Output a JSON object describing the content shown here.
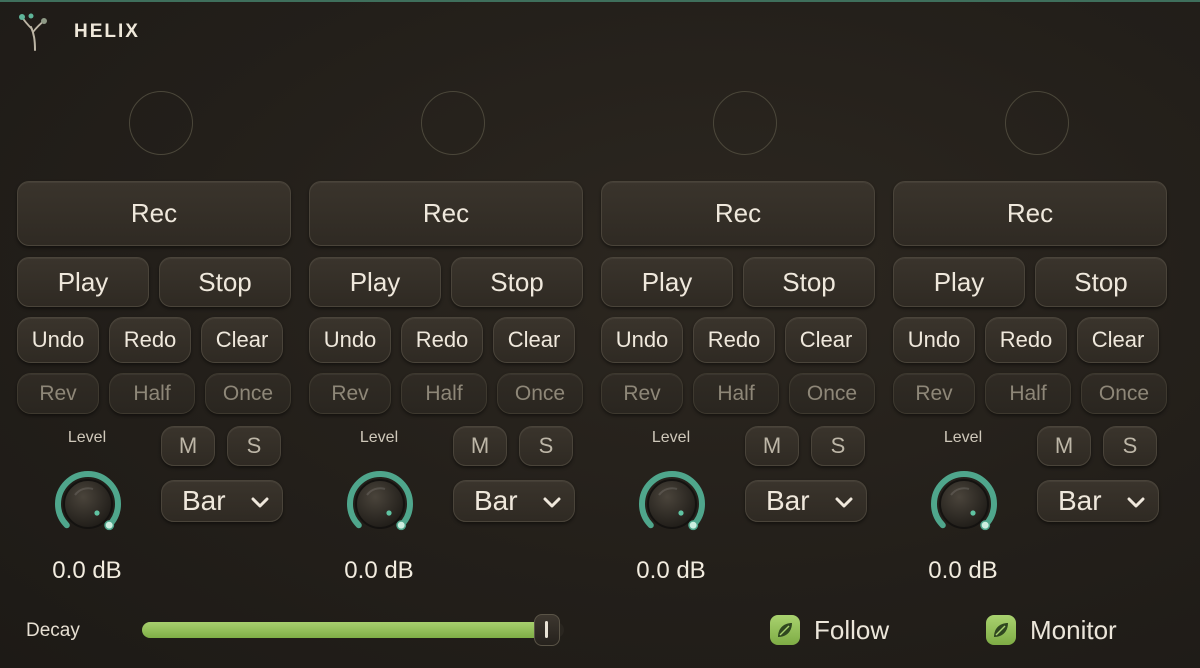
{
  "app": {
    "title": "HELIX"
  },
  "lanes": [
    {
      "rec": "Rec",
      "play": "Play",
      "stop": "Stop",
      "undo": "Undo",
      "redo": "Redo",
      "clear": "Clear",
      "rev": "Rev",
      "half": "Half",
      "once": "Once",
      "level_label": "Level",
      "level_value": "0.0 dB",
      "mute": "M",
      "solo": "S",
      "quantize": "Bar"
    },
    {
      "rec": "Rec",
      "play": "Play",
      "stop": "Stop",
      "undo": "Undo",
      "redo": "Redo",
      "clear": "Clear",
      "rev": "Rev",
      "half": "Half",
      "once": "Once",
      "level_label": "Level",
      "level_value": "0.0 dB",
      "mute": "M",
      "solo": "S",
      "quantize": "Bar"
    },
    {
      "rec": "Rec",
      "play": "Play",
      "stop": "Stop",
      "undo": "Undo",
      "redo": "Redo",
      "clear": "Clear",
      "rev": "Rev",
      "half": "Half",
      "once": "Once",
      "level_label": "Level",
      "level_value": "0.0 dB",
      "mute": "M",
      "solo": "S",
      "quantize": "Bar"
    },
    {
      "rec": "Rec",
      "play": "Play",
      "stop": "Stop",
      "undo": "Undo",
      "redo": "Redo",
      "clear": "Clear",
      "rev": "Rev",
      "half": "Half",
      "once": "Once",
      "level_label": "Level",
      "level_value": "0.0 dB",
      "mute": "M",
      "solo": "S",
      "quantize": "Bar"
    }
  ],
  "footer": {
    "decay_label": "Decay",
    "decay_fraction": 0.96,
    "follow_label": "Follow",
    "follow_on": true,
    "monitor_label": "Monitor",
    "monitor_on": true
  },
  "colors": {
    "accent_teal": "#4fa68c",
    "accent_green": "#9cc761",
    "background": "#231f1a"
  },
  "icons": {
    "logo": "sprout-logo-icon",
    "dropdown": "chevron-down-icon",
    "toggle": "leaf-icon"
  }
}
